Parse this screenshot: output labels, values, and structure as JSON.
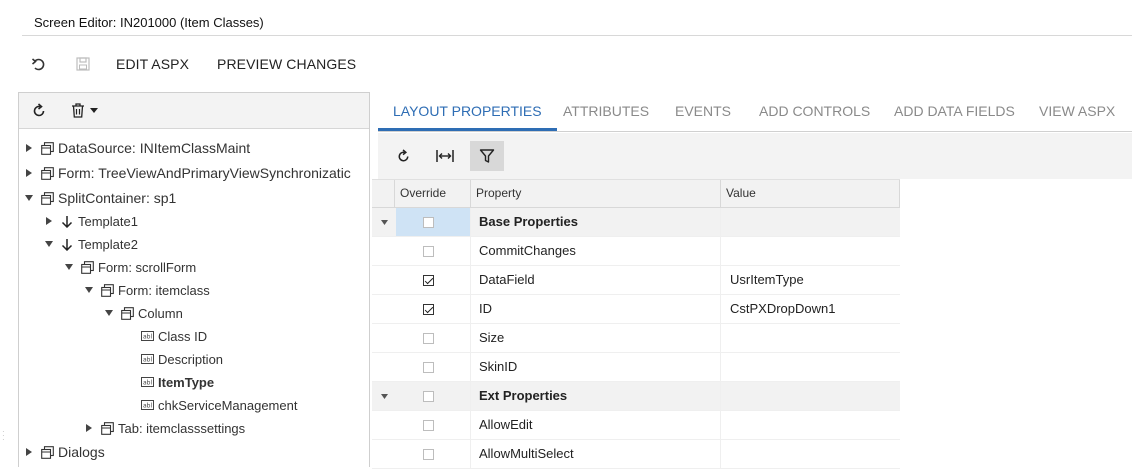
{
  "window": {
    "title": "Screen Editor: IN201000 (Item Classes)"
  },
  "toolbar": {
    "edit_aspx": "EDIT ASPX",
    "preview_changes": "PREVIEW CHANGES"
  },
  "tree": {
    "nodes": [
      {
        "label": "DataSource: INItemClassMaint"
      },
      {
        "label": "Form: TreeViewAndPrimaryViewSynchronizatic"
      },
      {
        "label": "SplitContainer: sp1"
      },
      {
        "label": "Template1"
      },
      {
        "label": "Template2"
      },
      {
        "label": "Form: scrollForm"
      },
      {
        "label": "Form: itemclass"
      },
      {
        "label": "Column"
      },
      {
        "label": "Class ID"
      },
      {
        "label": "Description"
      },
      {
        "label": "ItemType"
      },
      {
        "label": "chkServiceManagement"
      },
      {
        "label": "Tab: itemclasssettings"
      },
      {
        "label": "Dialogs"
      }
    ]
  },
  "tabs": [
    {
      "label": "LAYOUT PROPERTIES",
      "active": true
    },
    {
      "label": "ATTRIBUTES"
    },
    {
      "label": "EVENTS"
    },
    {
      "label": "ADD CONTROLS"
    },
    {
      "label": "ADD DATA FIELDS"
    },
    {
      "label": "VIEW ASPX"
    }
  ],
  "grid": {
    "headers": {
      "override": "Override",
      "property": "Property",
      "value": "Value"
    },
    "rows": [
      {
        "property": "Base Properties",
        "value": "",
        "checked": false,
        "group": true
      },
      {
        "property": "CommitChanges",
        "value": "",
        "checked": false
      },
      {
        "property": "DataField",
        "value": "UsrItemType",
        "checked": true
      },
      {
        "property": "ID",
        "value": "CstPXDropDown1",
        "checked": true
      },
      {
        "property": "Size",
        "value": "",
        "checked": false
      },
      {
        "property": "SkinID",
        "value": "",
        "checked": false
      },
      {
        "property": "Ext Properties",
        "value": "",
        "checked": false,
        "group": true
      },
      {
        "property": "AllowEdit",
        "value": "",
        "checked": false
      },
      {
        "property": "AllowMultiSelect",
        "value": "",
        "checked": false
      }
    ]
  },
  "icons": [
    "undo-icon",
    "save-icon",
    "refresh-icon",
    "delete-icon",
    "fit-columns-icon",
    "filter-icon"
  ],
  "colors": {
    "accent": "#2e6db4",
    "selected_cell": "#cfe3f5"
  }
}
